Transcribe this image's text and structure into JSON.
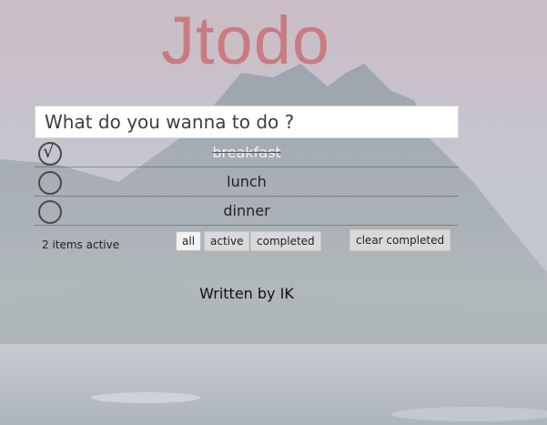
{
  "app": {
    "title": "Jtodo"
  },
  "new_todo": {
    "placeholder": "What do you wanna to do ?",
    "value": ""
  },
  "todos": [
    {
      "text": "breakfast",
      "completed": true,
      "check_glyph": "√"
    },
    {
      "text": "lunch",
      "completed": false,
      "check_glyph": ""
    },
    {
      "text": "dinner",
      "completed": false,
      "check_glyph": ""
    }
  ],
  "footer": {
    "count_text": "2 items active",
    "filters": [
      {
        "label": "all",
        "selected": true
      },
      {
        "label": "active",
        "selected": false
      },
      {
        "label": "completed",
        "selected": false
      }
    ],
    "clear_label": "clear completed"
  },
  "credit": "Written by IK",
  "colors": {
    "title": "#c9747a",
    "input_bg": "#ffffff",
    "button_bg": "#d9d9d9",
    "button_selected_bg": "#f2f2f2"
  }
}
